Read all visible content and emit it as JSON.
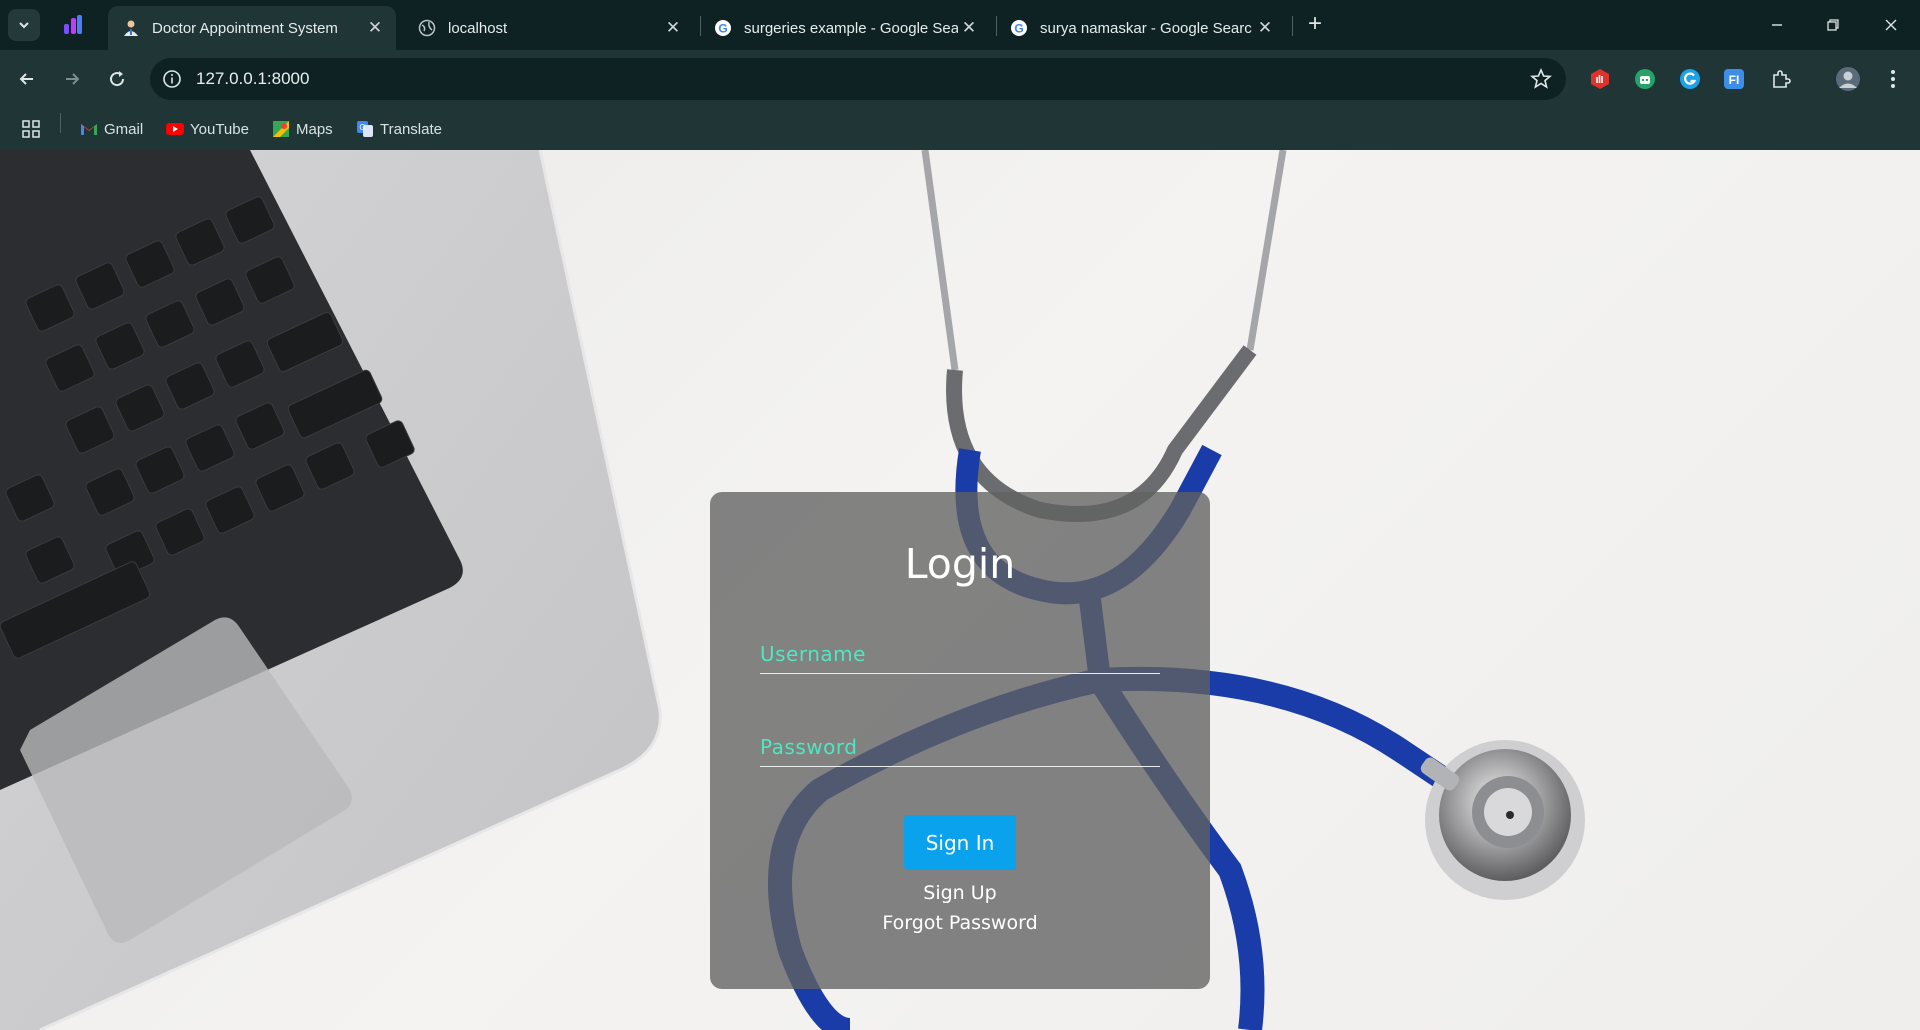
{
  "tabs": [
    {
      "title": "Doctor Appointment System",
      "favicon": "doctor-icon",
      "active": true
    },
    {
      "title": "localhost",
      "favicon": "globe-icon",
      "active": false
    },
    {
      "title": "surgeries example - Google Sea",
      "favicon": "google-icon",
      "active": false
    },
    {
      "title": "surya namaskar - Google Searc",
      "favicon": "google-icon",
      "active": false
    }
  ],
  "toolbar": {
    "url": "127.0.0.1:8000"
  },
  "bookmarks": [
    {
      "label": "Gmail",
      "icon": "gmail-icon"
    },
    {
      "label": "YouTube",
      "icon": "youtube-icon"
    },
    {
      "label": "Maps",
      "icon": "maps-icon"
    },
    {
      "label": "Translate",
      "icon": "translate-icon"
    }
  ],
  "login": {
    "title": "Login",
    "username_placeholder": "Username",
    "password_placeholder": "Password",
    "signin_label": "Sign In",
    "signup_label": "Sign Up",
    "forgot_label": "Forgot Password"
  },
  "colors": {
    "chrome_dark": "#0f2223",
    "chrome_toolbar": "#1f3536",
    "placeholder_accent": "#4fe6c1",
    "signin_button": "#0aa2ec",
    "card_overlay": "rgba(98,98,98,0.78)"
  }
}
